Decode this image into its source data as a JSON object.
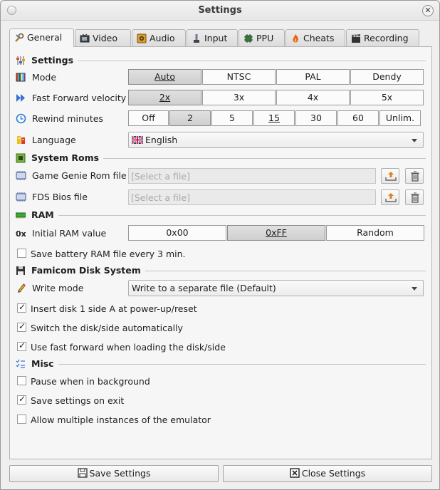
{
  "window": {
    "title": "Settings"
  },
  "tabs": [
    {
      "label": "General",
      "icon": "wrench-icon"
    },
    {
      "label": "Video",
      "icon": "tv-icon"
    },
    {
      "label": "Audio",
      "icon": "speaker-icon"
    },
    {
      "label": "Input",
      "icon": "joystick-icon"
    },
    {
      "label": "PPU",
      "icon": "chip-icon"
    },
    {
      "label": "Cheats",
      "icon": "flame-icon"
    },
    {
      "label": "Recording",
      "icon": "clapper-icon"
    }
  ],
  "settings": {
    "title": "Settings",
    "mode": {
      "label": "Mode",
      "options": [
        "Auto",
        "NTSC",
        "PAL",
        "Dendy"
      ],
      "selected": "Auto"
    },
    "ff": {
      "label": "Fast Forward velocity",
      "options": [
        "2x",
        "3x",
        "4x",
        "5x"
      ],
      "selected": "2x"
    },
    "rewind": {
      "label": "Rewind minutes",
      "options": [
        "Off",
        "2",
        "5",
        "15",
        "30",
        "60",
        "Unlim."
      ],
      "selected": "2"
    },
    "language": {
      "label": "Language",
      "value": "English"
    }
  },
  "roms": {
    "title": "System Roms",
    "gg": {
      "label": "Game Genie Rom file",
      "placeholder": "[Select a file]"
    },
    "fds": {
      "label": "FDS Bios file",
      "placeholder": "[Select a file]"
    }
  },
  "ram": {
    "title": "RAM",
    "initial": {
      "label": "Initial RAM value",
      "options": [
        "0x00",
        "0xFF",
        "Random"
      ],
      "selected": "0xFF"
    },
    "save_battery": {
      "label": "Save battery RAM file every 3 min.",
      "checked": false
    }
  },
  "fds": {
    "title": "Famicom Disk System",
    "write_mode": {
      "label": "Write mode",
      "value": "Write to a separate file (Default)"
    },
    "insert_disk": {
      "label": "Insert disk 1 side A at power-up/reset",
      "checked": true
    },
    "switch_disk": {
      "label": "Switch the disk/side automatically",
      "checked": true
    },
    "fast_forward": {
      "label": "Use fast forward when loading the disk/side",
      "checked": true
    }
  },
  "misc": {
    "title": "Misc",
    "pause_bg": {
      "label": "Pause when in background",
      "checked": false
    },
    "save_exit": {
      "label": "Save settings on exit",
      "checked": true
    },
    "multi_instance": {
      "label": "Allow multiple instances of the emulator",
      "checked": false
    }
  },
  "footer": {
    "save": "Save Settings",
    "close": "Close Settings"
  },
  "colors": {
    "accent": "#4a7fc1",
    "window_bg": "#efefef",
    "panel_bg": "#f6f6f6"
  }
}
